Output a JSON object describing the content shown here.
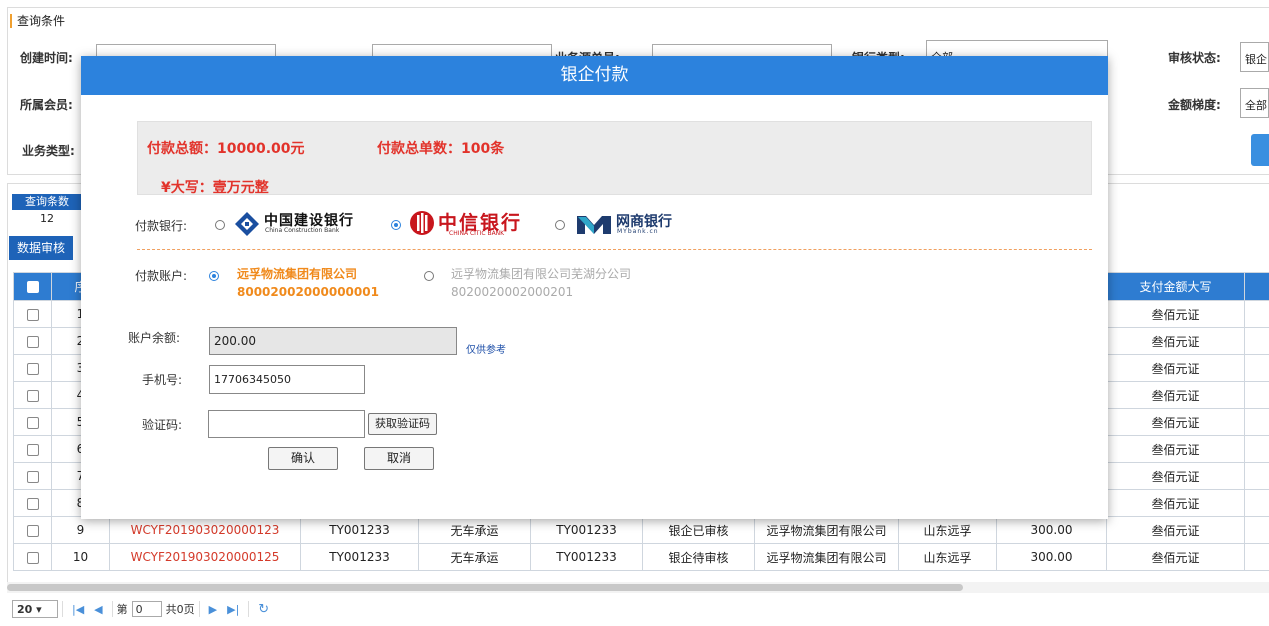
{
  "query": {
    "section_title": "查询条件",
    "labels": {
      "create_time": "创建时间:",
      "order_no": "业务源单号:",
      "bank_type": "银行类型:",
      "audit_status": "审核状态:",
      "member": "所属会员:",
      "amount_range": "金额梯度:",
      "biz_type": "业务类型:"
    },
    "bank_type_value": "全部",
    "audit_status_value": "银企",
    "amount_range_value": "全部"
  },
  "results": {
    "stat_title": "查询条数",
    "stat_value": "12",
    "audit_button": "数据审核",
    "columns": {
      "seq": "序",
      "amount_cn": "支付金额大写"
    },
    "rows": [
      {
        "seq": "1",
        "amount_cn": "叁佰元证"
      },
      {
        "seq": "2",
        "amount_cn": "叁佰元证"
      },
      {
        "seq": "3",
        "amount_cn": "叁佰元证"
      },
      {
        "seq": "4",
        "amount_cn": "叁佰元证"
      },
      {
        "seq": "5",
        "amount_cn": "叁佰元证"
      },
      {
        "seq": "6",
        "amount_cn": "叁佰元证"
      },
      {
        "seq": "7",
        "amount_cn": "叁佰元证"
      },
      {
        "seq": "8",
        "amount_cn": "叁佰元证"
      },
      {
        "seq": "9",
        "code": "WCYF201903020000123",
        "order": "TY001233",
        "type": "无车承运",
        "ref": "TY001233",
        "status": "银企已审核",
        "company": "远孚物流集团有限公司",
        "region": "山东远孚",
        "amount": "300.00",
        "amount_cn": "叁佰元证"
      },
      {
        "seq": "10",
        "code": "WCYF201903020000125",
        "order": "TY001233",
        "type": "无车承运",
        "ref": "TY001233",
        "status": "银企待审核",
        "company": "远孚物流集团有限公司",
        "region": "山东远孚",
        "amount": "300.00",
        "amount_cn": "叁佰元证"
      }
    ]
  },
  "pager": {
    "page_size": "20",
    "page_prefix": "第",
    "page_value": "0",
    "page_total": "共0页"
  },
  "modal": {
    "title": "银企付款",
    "total_amount": "付款总额：10000.00元",
    "total_count": "付款总单数：100条",
    "uppercase": "¥大写：壹万元整",
    "bank_label": "付款银行:",
    "banks": [
      {
        "cn": "中国建设银行",
        "en": "China Construction Bank",
        "color": "#1a4fa0"
      },
      {
        "cn": "中信银行",
        "en": "CHINA CITIC BANK",
        "color": "#c8161d"
      },
      {
        "cn": "网商银行",
        "en": "MYbank.cn",
        "color": "#1e3b6e"
      }
    ],
    "account_label": "付款账户:",
    "accounts": [
      {
        "name": "远孚物流集团有限公司",
        "number": "80002002000000001"
      },
      {
        "name": "远孚物流集团有限公司芜湖分公司",
        "number": "8020020002000201"
      }
    ],
    "balance_label": "账户余额:",
    "balance_value": "200.00",
    "reference_note": "仅供参考",
    "phone_label": "手机号:",
    "phone_value": "17706345050",
    "code_label": "验证码:",
    "code_value": "",
    "get_code_button": "获取验证码",
    "confirm_button": "确认",
    "cancel_button": "取消"
  }
}
